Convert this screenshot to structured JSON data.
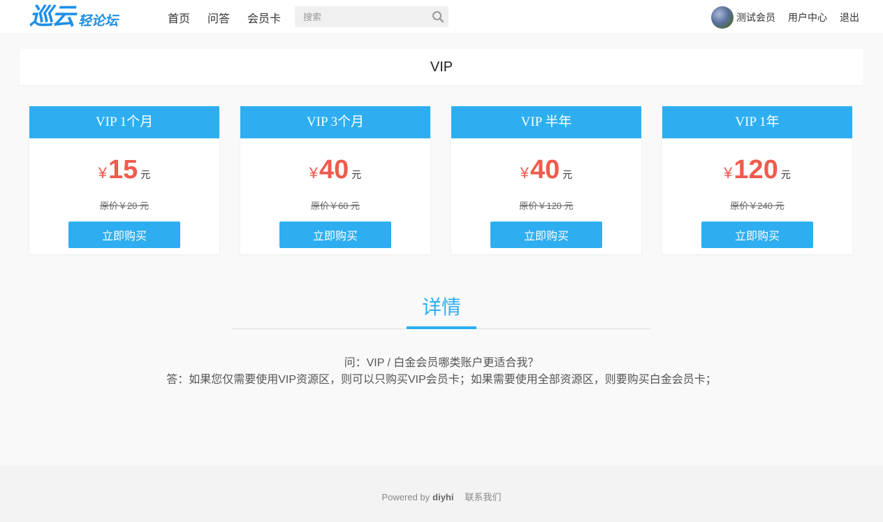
{
  "header": {
    "logo_main": "巡云",
    "logo_sub": "轻论坛",
    "nav": [
      "首页",
      "问答",
      "会员卡"
    ],
    "search_placeholder": "搜索",
    "user_name": "测试会员",
    "user_center": "用户中心",
    "logout": "退出"
  },
  "page_title": "VIP",
  "cards": [
    {
      "title": "VIP 1个月",
      "currency": "¥",
      "price": "15",
      "unit": "元",
      "original": "原价￥20 元",
      "buy": "立即购买"
    },
    {
      "title": "VIP 3个月",
      "currency": "¥",
      "price": "40",
      "unit": "元",
      "original": "原价￥60 元",
      "buy": "立即购买"
    },
    {
      "title": "VIP 半年",
      "currency": "¥",
      "price": "40",
      "unit": "元",
      "original": "原价￥120 元",
      "buy": "立即购买"
    },
    {
      "title": "VIP 1年",
      "currency": "¥",
      "price": "120",
      "unit": "元",
      "original": "原价￥240 元",
      "buy": "立即购买"
    }
  ],
  "details": {
    "title": "详情",
    "question": "问：VIP / 白金会员哪类账户更适合我？",
    "answer": "答：如果您仅需要使用VIP资源区，则可以只购买VIP会员卡；如果需要使用全部资源区，则要购买白金会员卡；"
  },
  "footer": {
    "powered_by": "Powered by",
    "brand": "diyhi",
    "contact": "联系我们"
  },
  "colors": {
    "accent": "#2eaef0",
    "price": "#ef5b4d",
    "logo": "#1e90e6"
  }
}
